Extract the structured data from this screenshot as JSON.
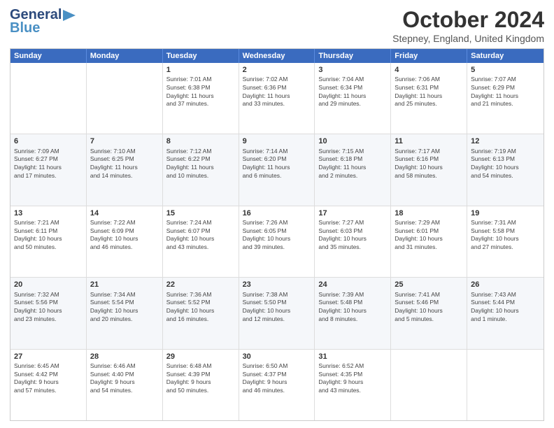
{
  "logo": {
    "line1": "General",
    "line2": "Blue"
  },
  "title": "October 2024",
  "location": "Stepney, England, United Kingdom",
  "days": [
    "Sunday",
    "Monday",
    "Tuesday",
    "Wednesday",
    "Thursday",
    "Friday",
    "Saturday"
  ],
  "weeks": [
    [
      {
        "day": "",
        "info": ""
      },
      {
        "day": "",
        "info": ""
      },
      {
        "day": "1",
        "info": "Sunrise: 7:01 AM\nSunset: 6:38 PM\nDaylight: 11 hours\nand 37 minutes."
      },
      {
        "day": "2",
        "info": "Sunrise: 7:02 AM\nSunset: 6:36 PM\nDaylight: 11 hours\nand 33 minutes."
      },
      {
        "day": "3",
        "info": "Sunrise: 7:04 AM\nSunset: 6:34 PM\nDaylight: 11 hours\nand 29 minutes."
      },
      {
        "day": "4",
        "info": "Sunrise: 7:06 AM\nSunset: 6:31 PM\nDaylight: 11 hours\nand 25 minutes."
      },
      {
        "day": "5",
        "info": "Sunrise: 7:07 AM\nSunset: 6:29 PM\nDaylight: 11 hours\nand 21 minutes."
      }
    ],
    [
      {
        "day": "6",
        "info": "Sunrise: 7:09 AM\nSunset: 6:27 PM\nDaylight: 11 hours\nand 17 minutes."
      },
      {
        "day": "7",
        "info": "Sunrise: 7:10 AM\nSunset: 6:25 PM\nDaylight: 11 hours\nand 14 minutes."
      },
      {
        "day": "8",
        "info": "Sunrise: 7:12 AM\nSunset: 6:22 PM\nDaylight: 11 hours\nand 10 minutes."
      },
      {
        "day": "9",
        "info": "Sunrise: 7:14 AM\nSunset: 6:20 PM\nDaylight: 11 hours\nand 6 minutes."
      },
      {
        "day": "10",
        "info": "Sunrise: 7:15 AM\nSunset: 6:18 PM\nDaylight: 11 hours\nand 2 minutes."
      },
      {
        "day": "11",
        "info": "Sunrise: 7:17 AM\nSunset: 6:16 PM\nDaylight: 10 hours\nand 58 minutes."
      },
      {
        "day": "12",
        "info": "Sunrise: 7:19 AM\nSunset: 6:13 PM\nDaylight: 10 hours\nand 54 minutes."
      }
    ],
    [
      {
        "day": "13",
        "info": "Sunrise: 7:21 AM\nSunset: 6:11 PM\nDaylight: 10 hours\nand 50 minutes."
      },
      {
        "day": "14",
        "info": "Sunrise: 7:22 AM\nSunset: 6:09 PM\nDaylight: 10 hours\nand 46 minutes."
      },
      {
        "day": "15",
        "info": "Sunrise: 7:24 AM\nSunset: 6:07 PM\nDaylight: 10 hours\nand 43 minutes."
      },
      {
        "day": "16",
        "info": "Sunrise: 7:26 AM\nSunset: 6:05 PM\nDaylight: 10 hours\nand 39 minutes."
      },
      {
        "day": "17",
        "info": "Sunrise: 7:27 AM\nSunset: 6:03 PM\nDaylight: 10 hours\nand 35 minutes."
      },
      {
        "day": "18",
        "info": "Sunrise: 7:29 AM\nSunset: 6:01 PM\nDaylight: 10 hours\nand 31 minutes."
      },
      {
        "day": "19",
        "info": "Sunrise: 7:31 AM\nSunset: 5:58 PM\nDaylight: 10 hours\nand 27 minutes."
      }
    ],
    [
      {
        "day": "20",
        "info": "Sunrise: 7:32 AM\nSunset: 5:56 PM\nDaylight: 10 hours\nand 23 minutes."
      },
      {
        "day": "21",
        "info": "Sunrise: 7:34 AM\nSunset: 5:54 PM\nDaylight: 10 hours\nand 20 minutes."
      },
      {
        "day": "22",
        "info": "Sunrise: 7:36 AM\nSunset: 5:52 PM\nDaylight: 10 hours\nand 16 minutes."
      },
      {
        "day": "23",
        "info": "Sunrise: 7:38 AM\nSunset: 5:50 PM\nDaylight: 10 hours\nand 12 minutes."
      },
      {
        "day": "24",
        "info": "Sunrise: 7:39 AM\nSunset: 5:48 PM\nDaylight: 10 hours\nand 8 minutes."
      },
      {
        "day": "25",
        "info": "Sunrise: 7:41 AM\nSunset: 5:46 PM\nDaylight: 10 hours\nand 5 minutes."
      },
      {
        "day": "26",
        "info": "Sunrise: 7:43 AM\nSunset: 5:44 PM\nDaylight: 10 hours\nand 1 minute."
      }
    ],
    [
      {
        "day": "27",
        "info": "Sunrise: 6:45 AM\nSunset: 4:42 PM\nDaylight: 9 hours\nand 57 minutes."
      },
      {
        "day": "28",
        "info": "Sunrise: 6:46 AM\nSunset: 4:40 PM\nDaylight: 9 hours\nand 54 minutes."
      },
      {
        "day": "29",
        "info": "Sunrise: 6:48 AM\nSunset: 4:39 PM\nDaylight: 9 hours\nand 50 minutes."
      },
      {
        "day": "30",
        "info": "Sunrise: 6:50 AM\nSunset: 4:37 PM\nDaylight: 9 hours\nand 46 minutes."
      },
      {
        "day": "31",
        "info": "Sunrise: 6:52 AM\nSunset: 4:35 PM\nDaylight: 9 hours\nand 43 minutes."
      },
      {
        "day": "",
        "info": ""
      },
      {
        "day": "",
        "info": ""
      }
    ]
  ]
}
